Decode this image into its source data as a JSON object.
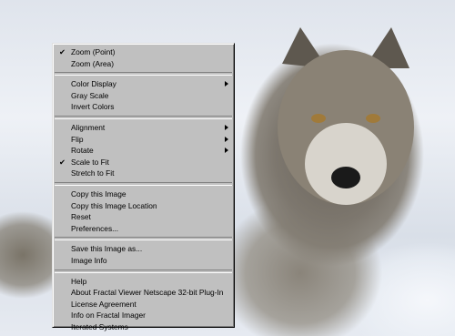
{
  "context_menu": {
    "groups": [
      [
        {
          "label": "Zoom (Point)",
          "checked": true,
          "submenu": false
        },
        {
          "label": "Zoom (Area)",
          "checked": false,
          "submenu": false
        }
      ],
      [
        {
          "label": "Color Display",
          "checked": false,
          "submenu": true
        },
        {
          "label": "Gray Scale",
          "checked": false,
          "submenu": false
        },
        {
          "label": "Invert Colors",
          "checked": false,
          "submenu": false
        }
      ],
      [
        {
          "label": "Alignment",
          "checked": false,
          "submenu": true
        },
        {
          "label": "Flip",
          "checked": false,
          "submenu": true
        },
        {
          "label": "Rotate",
          "checked": false,
          "submenu": true
        },
        {
          "label": "Scale to Fit",
          "checked": true,
          "submenu": false
        },
        {
          "label": "Stretch to Fit",
          "checked": false,
          "submenu": false
        }
      ],
      [
        {
          "label": "Copy this Image",
          "checked": false,
          "submenu": false
        },
        {
          "label": "Copy this Image Location",
          "checked": false,
          "submenu": false
        },
        {
          "label": "Reset",
          "checked": false,
          "submenu": false
        },
        {
          "label": "Preferences...",
          "checked": false,
          "submenu": false
        }
      ],
      [
        {
          "label": "Save this Image as...",
          "checked": false,
          "submenu": false
        },
        {
          "label": "Image Info",
          "checked": false,
          "submenu": false
        }
      ],
      [
        {
          "label": "Help",
          "checked": false,
          "submenu": false
        },
        {
          "label": "About Fractal Viewer Netscape 32-bit Plug-In",
          "checked": false,
          "submenu": false
        },
        {
          "label": "License Agreement",
          "checked": false,
          "submenu": false
        },
        {
          "label": "Info on Fractal Imager",
          "checked": false,
          "submenu": false
        },
        {
          "label": "Iterated Systems",
          "checked": false,
          "submenu": false
        }
      ]
    ],
    "check_glyph": "✔"
  },
  "colors": {
    "menu_bg": "#c0c0c0",
    "text": "#000000"
  }
}
